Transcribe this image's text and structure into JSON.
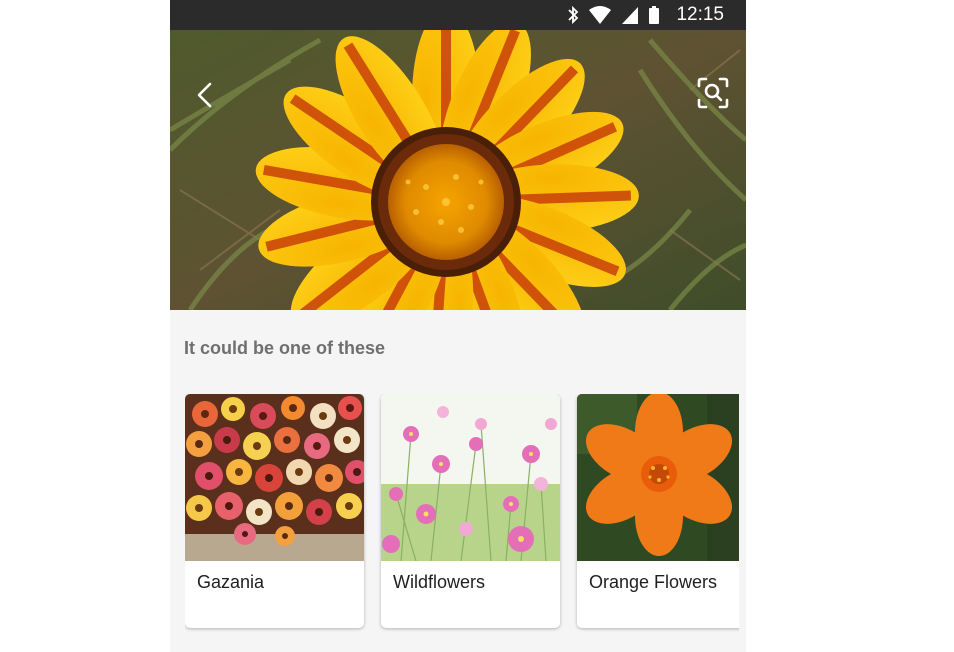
{
  "status_bar": {
    "time": "12:15",
    "icons": [
      "bluetooth-icon",
      "wifi-icon",
      "signal-icon",
      "battery-icon"
    ]
  },
  "header": {
    "back_icon": "chevron-left-icon",
    "lens_icon": "lens-search-icon"
  },
  "results": {
    "title": "It could be one of these",
    "items": [
      {
        "label": "Gazania"
      },
      {
        "label": "Wildflowers"
      },
      {
        "label": "Orange Flowers"
      }
    ]
  },
  "colors": {
    "status_bar_bg": "#2b2b2b",
    "sheet_bg": "#f5f5f5",
    "section_title": "#6f6f6f"
  }
}
